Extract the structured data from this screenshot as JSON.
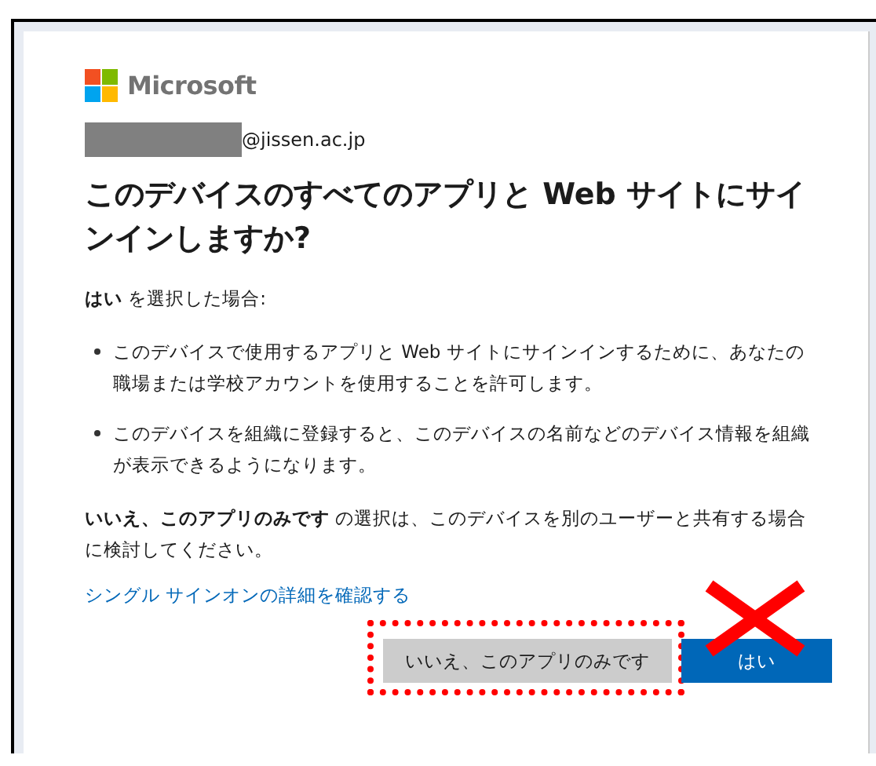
{
  "brand": {
    "name": "Microsoft"
  },
  "account": {
    "redacted": true,
    "domain": "@jissen.ac.jp"
  },
  "heading": "このデバイスのすべてのアプリと Web サイトにサインインしますか?",
  "intro": "**はい** を選択した場合:",
  "bullets": [
    "このデバイスで使用するアプリと Web サイトにサインインするために、あなたの職場または学校アカウントを使用することを許可します。",
    "このデバイスを組織に登録すると、このデバイスの名前などのデバイス情報を組織が表示できるようになります。"
  ],
  "note": "**いいえ、このアプリのみです** の選択は、このデバイスを別のユーザーと共有する場合に検討してください。",
  "link": "シングル サインオンの詳細を確認する",
  "buttons": [
    {
      "label": "いいえ、このアプリのみです",
      "kind": "secondary",
      "highlighted": true,
      "crossed": false
    },
    {
      "label": "はい",
      "kind": "primary",
      "highlighted": false,
      "crossed": true
    }
  ]
}
